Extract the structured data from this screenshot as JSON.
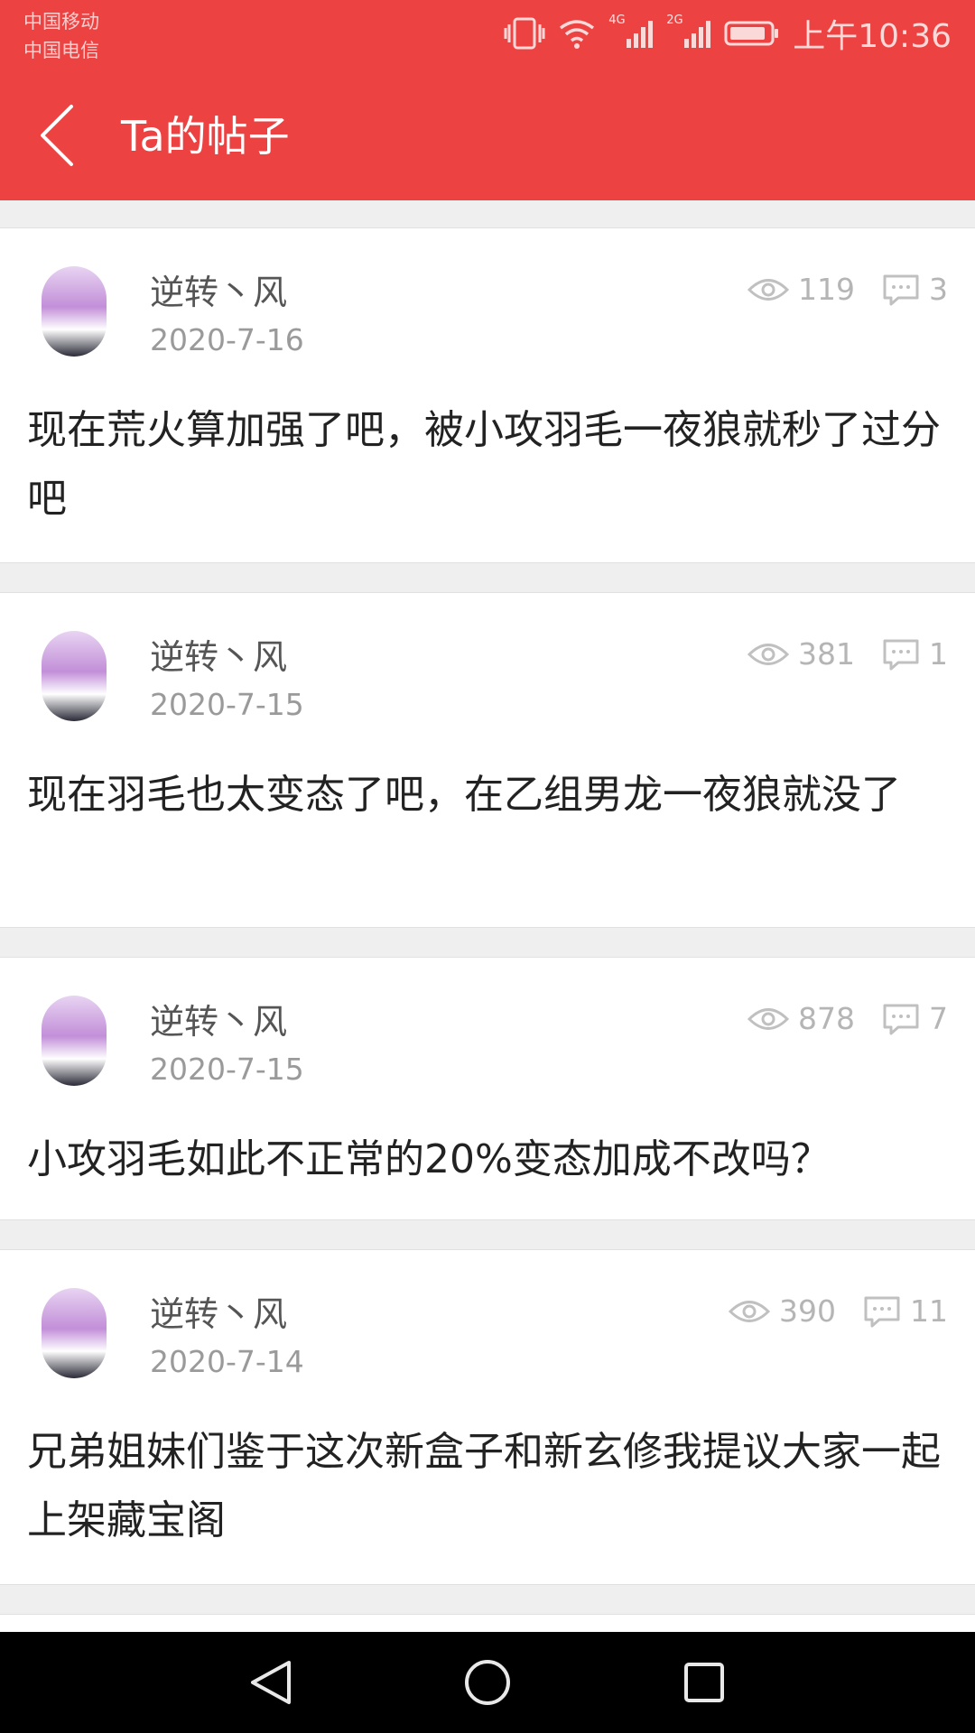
{
  "status_bar": {
    "carrier1": "中国移动",
    "carrier2": "中国电信",
    "network1": "4G",
    "network2": "2G",
    "time": "上午10:36",
    "icons": [
      "vibrate-icon",
      "wifi-icon",
      "signal-icon",
      "signal-icon",
      "battery-icon"
    ]
  },
  "header": {
    "title": "Ta的帖子",
    "back_icon": "chevron-left-icon",
    "background": "#ec4242"
  },
  "posts": [
    {
      "author": "逆转丶风",
      "date": "2020-7-16",
      "views": "119",
      "comments": "3",
      "content": "现在荒火算加强了吧，被小攻羽毛一夜狼就秒了过分吧"
    },
    {
      "author": "逆转丶风",
      "date": "2020-7-15",
      "views": "381",
      "comments": "1",
      "content": "现在羽毛也太变态了吧，在乙组男龙一夜狼就没了"
    },
    {
      "author": "逆转丶风",
      "date": "2020-7-15",
      "views": "878",
      "comments": "7",
      "content": "小攻羽毛如此不正常的20%变态加成不改吗？"
    },
    {
      "author": "逆转丶风",
      "date": "2020-7-14",
      "views": "390",
      "comments": "11",
      "content": "兄弟姐妹们鉴于这次新盒子和新玄修我提议大家一起上架藏宝阁"
    }
  ],
  "nav_bar": {
    "buttons": [
      "back-triangle-icon",
      "home-circle-icon",
      "recents-square-icon"
    ]
  }
}
